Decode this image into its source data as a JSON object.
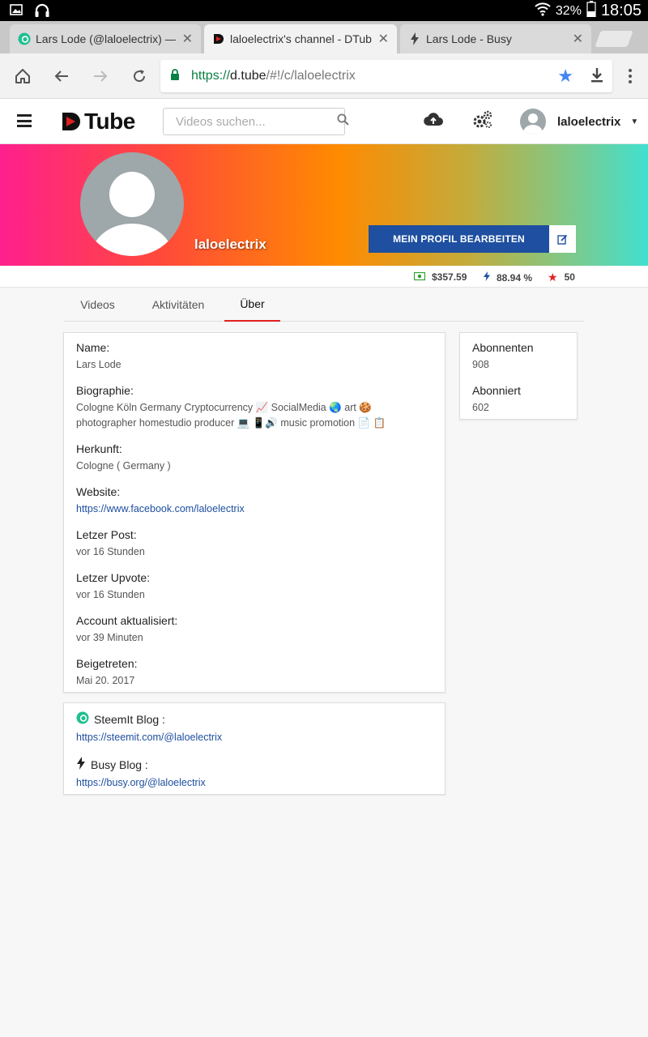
{
  "status_bar": {
    "battery": "32%",
    "time": "18:05"
  },
  "browser": {
    "tabs": [
      {
        "title": "Lars Lode (@laloelectrix) — S",
        "icon": "steemit-icon",
        "active": false
      },
      {
        "title": "laloelectrix's channel - DTube",
        "icon": "dtube-icon",
        "active": true
      },
      {
        "title": "Lars Lode - Busy",
        "icon": "busy-icon",
        "active": false
      }
    ],
    "url_scheme": "https://",
    "url_host": "d.tube",
    "url_path": "/#!/c/laloelectrix"
  },
  "header": {
    "logo_text": "Tube",
    "search_placeholder": "Videos suchen...",
    "username": "laloelectrix"
  },
  "profile": {
    "channel_name": "laloelectrix",
    "edit_label": "MEIN PROFIL BEARBEITEN",
    "stats": {
      "balance": "$357.59",
      "voting_power": "88.94 %",
      "reputation": "50"
    }
  },
  "tabs": {
    "videos": "Videos",
    "activities": "Aktivitäten",
    "about": "Über"
  },
  "about": {
    "name_label": "Name:",
    "name_value": "Lars Lode",
    "bio_label": "Biographie:",
    "bio_line1": "Cologne Köln Germany Cryptocurrency 📈 SocialMedia 🌏 art 🍪",
    "bio_line2": "photographer   homestudio producer 💻 📱🔊 music promotion 📄 📋",
    "origin_label": "Herkunft:",
    "origin_value": "Cologne ( Germany )",
    "website_label": "Website:",
    "website_value": "https://www.facebook.com/laloelectrix",
    "last_post_label": "Letzer Post:",
    "last_post_value": "vor 16 Stunden",
    "last_upvote_label": "Letzer Upvote:",
    "last_upvote_value": "vor 16 Stunden",
    "account_updated_label": "Account aktualisiert:",
    "account_updated_value": "vor 39 Minuten",
    "joined_label": "Beigetreten:",
    "joined_value": "Mai 20. 2017"
  },
  "blogs": {
    "steemit_label": "SteemIt Blog :",
    "steemit_url": "https://steemit.com/@laloelectrix",
    "busy_label": "Busy Blog :",
    "busy_url": "https://busy.org/@laloelectrix"
  },
  "followers": {
    "subscribers_label": "Abonnenten",
    "subscribers_value": "908",
    "subscribed_label": "Abonniert",
    "subscribed_value": "602"
  },
  "colors": {
    "dtube_red": "#e02020",
    "edit_blue": "#1e4fa0",
    "link_blue": "#1e4fa0",
    "steemit_green": "#1fbf8f"
  }
}
